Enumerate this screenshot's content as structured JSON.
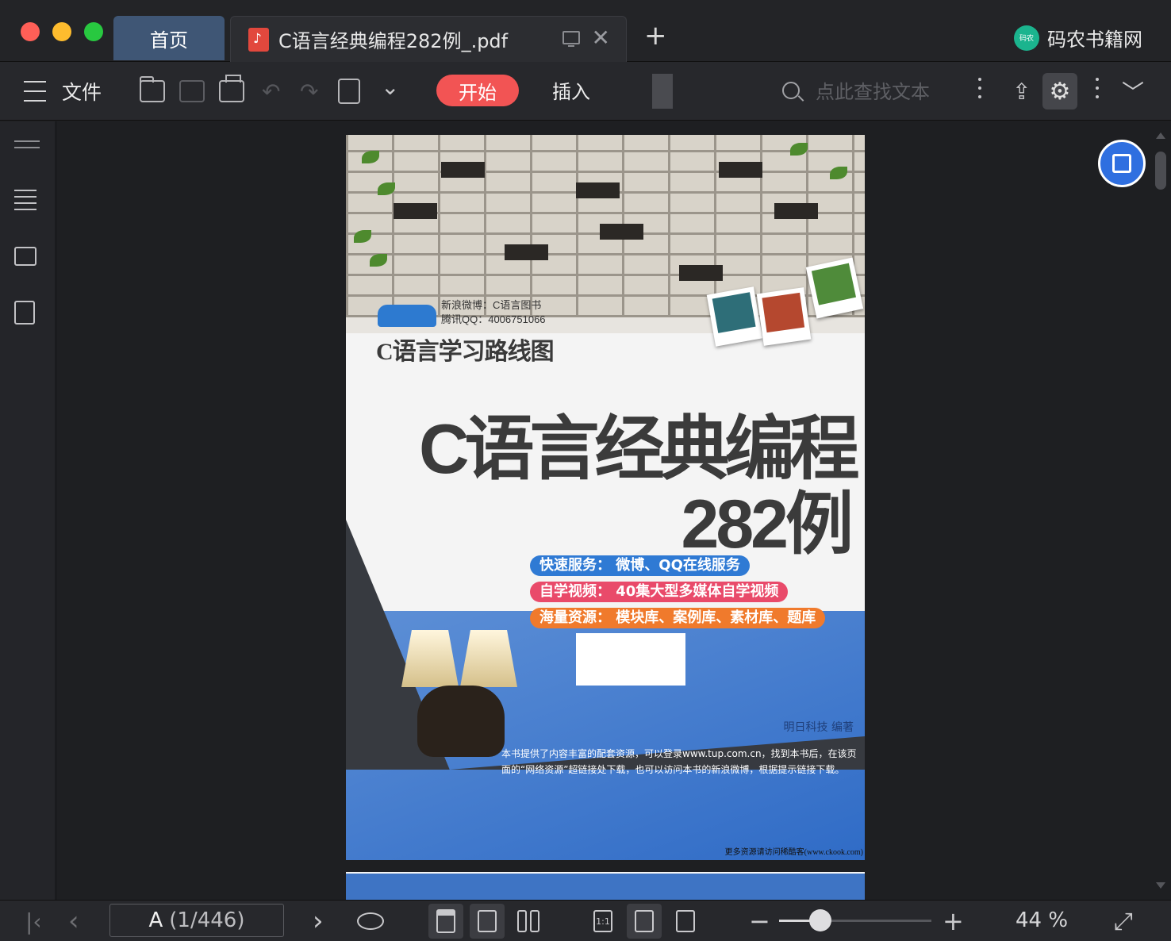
{
  "window": {
    "home_tab": "首页",
    "doc_tab_title": "C语言经典编程282例_.pdf",
    "new_tab": "+",
    "close_tab": "✕",
    "brand_logo_text": "码农",
    "brand_name": "码农书籍网"
  },
  "toolbar": {
    "file_label": "文件",
    "start_label": "开始",
    "insert_label": "插入",
    "search_placeholder": "点此查找文本",
    "undo": "↶",
    "redo": "↷",
    "dropdown": "⌄",
    "more": "⌵",
    "gear": "⚙",
    "share": "⇪",
    "chevron": "﹀"
  },
  "sidebar": {
    "icons": [
      "collapse-icon",
      "outline-icon",
      "thumbnail-icon",
      "convert-icon"
    ]
  },
  "cover": {
    "weibo_line": "新浪微博：C语言图书",
    "qq_line": "腾讯QQ：4006751066",
    "roadmap": "C语言学习路线图",
    "title": "C语言经典编程",
    "number": "282例",
    "pill_1": "快速服务：  微博、QQ在线服务",
    "pill_2": "自学视频：  40集大型多媒体自学视频",
    "pill_3": "海量资源：  模块库、案例库、素材库、题库",
    "author": "明日科技    编著",
    "blurb": "本书提供了内容丰富的配套资源，可以登录www.tup.com.cn，找到本书后，在该页面的“网络资源”超链接处下载，也可以访问本书的新浪微博，根据提示链接下载。",
    "footer_note": "更多资源请访问稀酷客(www.ckook.com)"
  },
  "statusbar": {
    "first_page": "|‹",
    "prev_page": "‹",
    "next_page": "›",
    "current_page_label": "A",
    "page_range": "(1/446)",
    "zoom_out": "−",
    "zoom_in": "+",
    "zoom_value": "44 %",
    "zoom_fraction": 0.27,
    "fullscreen": "⤢"
  },
  "colors": {
    "accent_red": "#f25454",
    "home_tab_bg": "#3f5675",
    "float_btn": "#2f6fe0"
  }
}
